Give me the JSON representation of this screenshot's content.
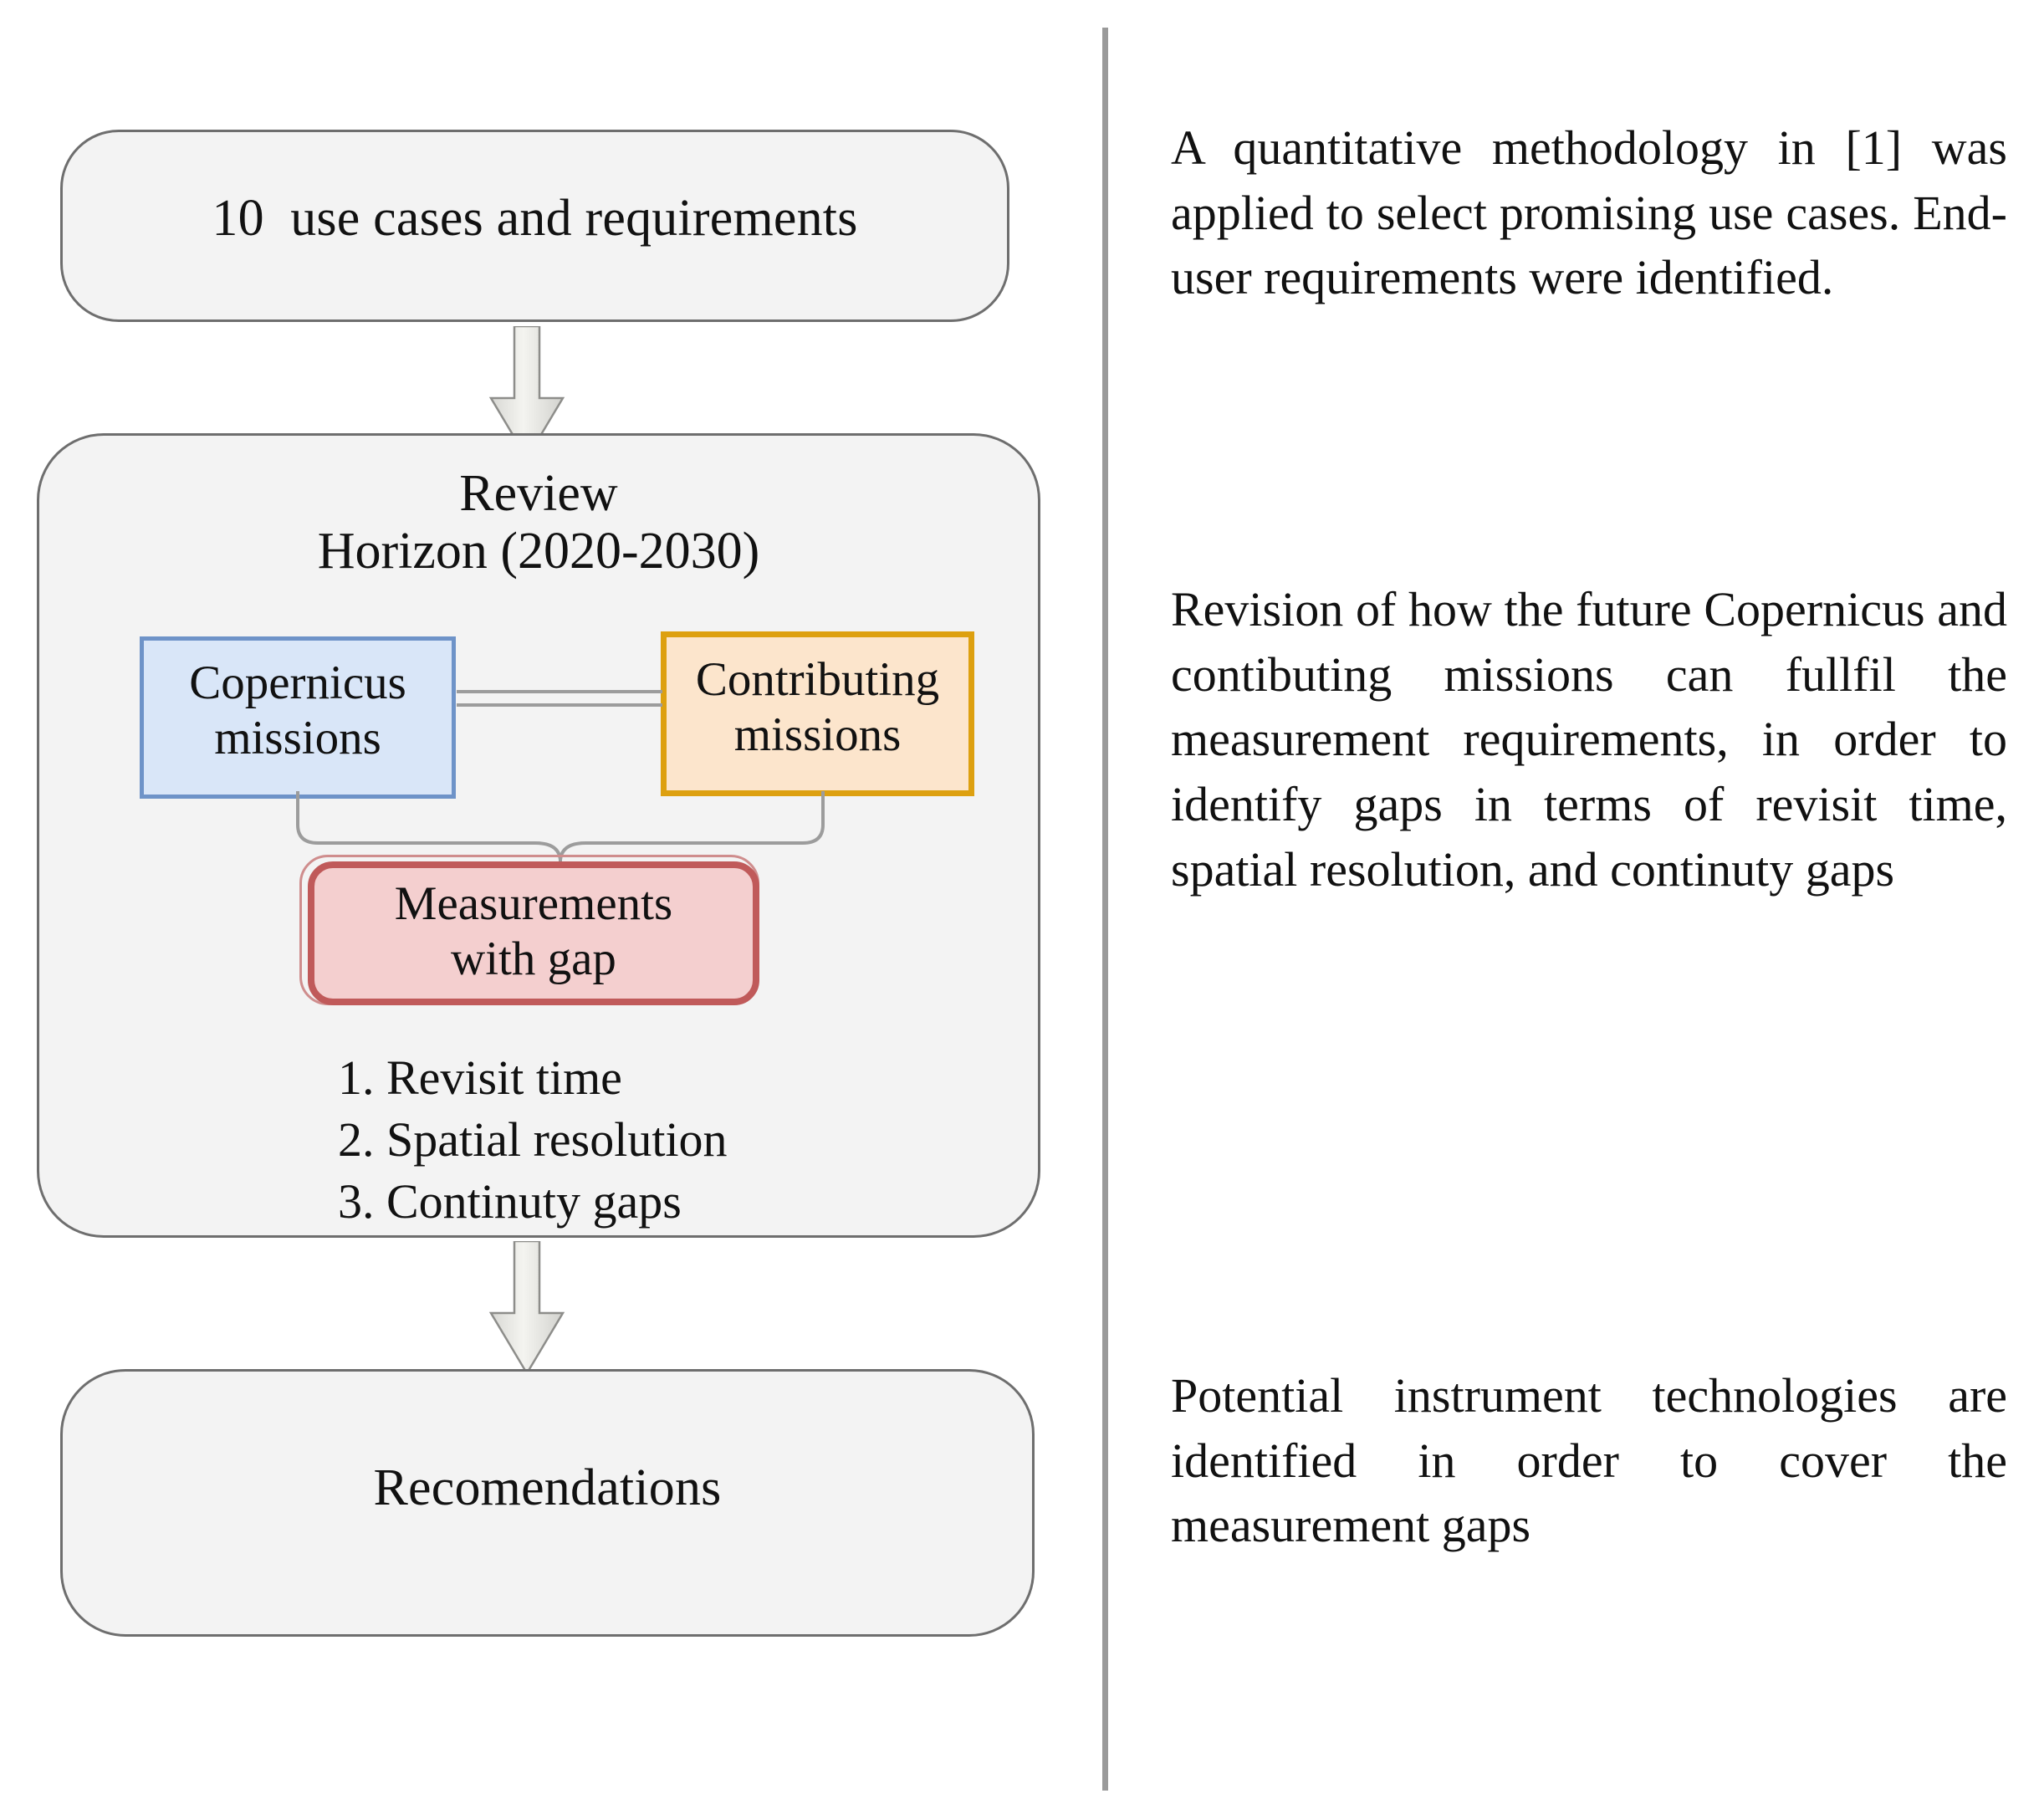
{
  "figure": {
    "type": "flow-diagram",
    "divider": {
      "color": "#9a9a9a"
    }
  },
  "flow": {
    "step_usecases": {
      "label": "10  use cases and requirements",
      "fill": "#f3f3f3",
      "border": "#6e6e6e"
    },
    "step_review": {
      "title_line_1": "Review",
      "title_line_2": "Horizon  (2020-2030)",
      "fill": "#f3f3f3",
      "border": "#6e6e6e"
    },
    "step_recommendations": {
      "label": "Recomendations",
      "fill": "#f3f3f3",
      "border": "#6e6e6e"
    },
    "arrow_1_name": "down-arrow-usecases-to-review",
    "arrow_2_name": "down-arrow-review-to-recommendations"
  },
  "missions": {
    "copernicus": {
      "line_1": "Copernicus",
      "line_2": "missions",
      "fill": "#d9e6f8",
      "border": "#6e93c8"
    },
    "contributing": {
      "line_1": "Contributing",
      "line_2": "missions",
      "fill": "#fce5cc",
      "border": "#dda010"
    }
  },
  "measurements": {
    "line_1": "Measurements",
    "line_2": "with gap",
    "fill": "#f4cfcf",
    "border": "#c05a5a",
    "outer_border": "#cf8d8d"
  },
  "gaps": {
    "items": [
      "1. Revisit time",
      "2. Spatial resolution",
      "3. Continuty gaps"
    ]
  },
  "notes": {
    "note_1": "A quantitative methodology in [1] was applied to select promising use cases. End-user requirements were identified.",
    "note_2": "Revision of how the future Copernicus and contibuting missions can fullfil the measurement requirements, in order to identify gaps in terms of revisit time, spatial resolution, and continuty gaps",
    "note_3": "Potential instrument technologies are identified in order to cover the measurement gaps"
  }
}
